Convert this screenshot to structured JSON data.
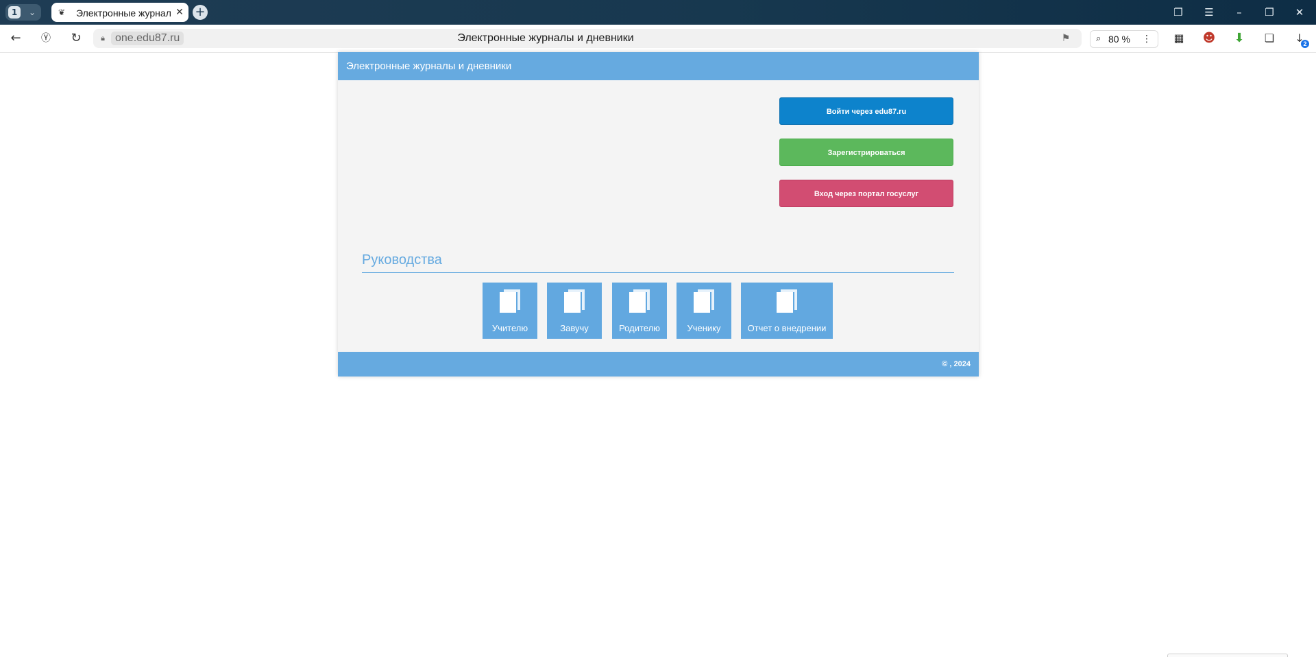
{
  "browser": {
    "tab_count": "1",
    "tab_title": "Электронные журналы и дневники",
    "domain": "one.edu87.ru",
    "page_title": "Электронные журналы и дневники",
    "zoom": "80 %",
    "downloads_badge": "2",
    "icons": {
      "back": "back-arrow-icon",
      "yandex": "yandex-logo-icon",
      "reload": "reload-icon",
      "lock": "lock-icon",
      "bookmark": "bookmark-icon",
      "search": "search-icon",
      "menu": "hamburger-icon"
    }
  },
  "page": {
    "header_title": "Электронные журналы и дневники",
    "buttons": {
      "login": "Войти через edu87.ru",
      "register": "Зарегистрироваться",
      "gosuslugi": "Вход через портал госуслуг"
    },
    "guides": {
      "title": "Руководства",
      "items": [
        {
          "label": "Учителю"
        },
        {
          "label": "Завучу"
        },
        {
          "label": "Родителю"
        },
        {
          "label": "Ученику"
        },
        {
          "label": "Отчет о внедрении"
        }
      ]
    },
    "footer_copyright": "© , 2024"
  },
  "colors": {
    "header_blue": "#66aae0",
    "login_button": "#0d83cc",
    "register_button": "#5cb85c",
    "gosuslugi_button": "#d24d72"
  }
}
